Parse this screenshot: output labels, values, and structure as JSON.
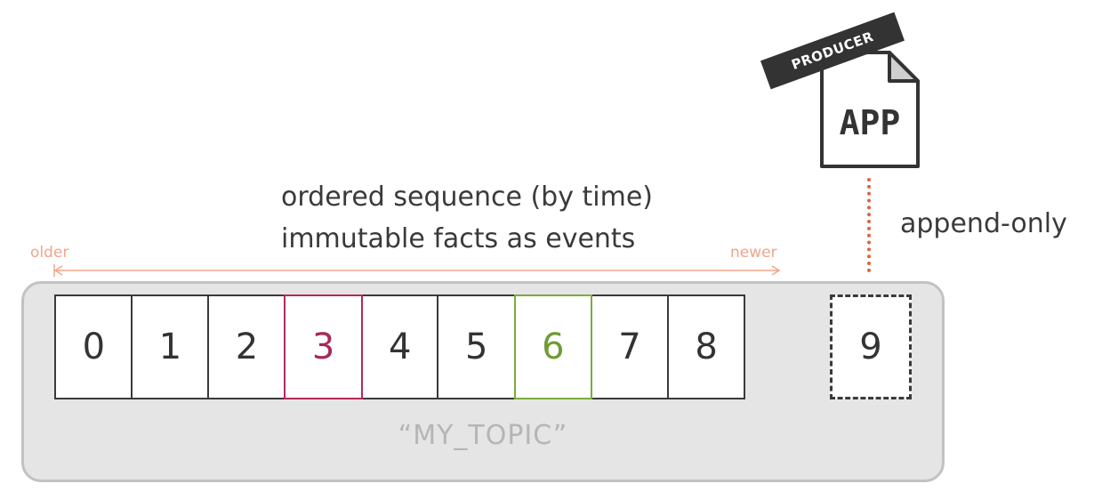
{
  "description": {
    "line1": "ordered sequence (by time)",
    "line2": "immutable facts as events"
  },
  "timeline": {
    "older_label": "older",
    "newer_label": "newer"
  },
  "topic": {
    "name": "“MY_TOPIC”",
    "cells": [
      "0",
      "1",
      "2",
      "3",
      "4",
      "5",
      "6",
      "7",
      "8"
    ],
    "highlight_red_index": 3,
    "highlight_green_index": 6,
    "new_cell": "9"
  },
  "producer": {
    "tag": "PRODUCER",
    "app_label": "APP"
  },
  "append_label": "append-only",
  "colors": {
    "red_highlight": "#b12a5e",
    "green_highlight": "#7cab3e",
    "timeline": "#f0a58a",
    "append_line": "#e2623b",
    "topic_bg": "#e5e5e5"
  }
}
